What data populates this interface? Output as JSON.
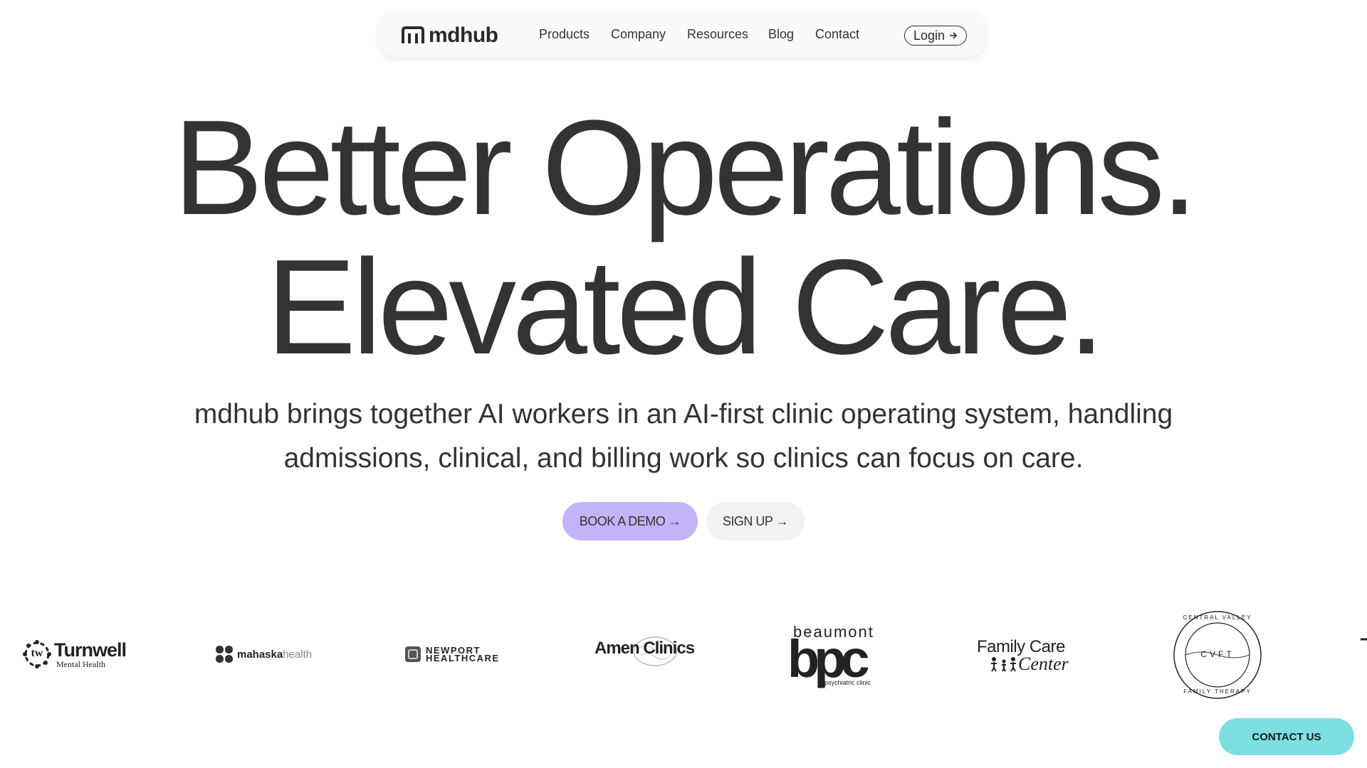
{
  "nav": {
    "brand": "mdhub",
    "items": [
      {
        "label": "Products"
      },
      {
        "label": "Company"
      },
      {
        "label": "Resources"
      },
      {
        "label": "Blog"
      },
      {
        "label": "Contact"
      }
    ],
    "login_label": "Login"
  },
  "hero": {
    "line1": "Better Operations.",
    "line2": "Elevated Care.",
    "subtext": "mdhub brings together AI workers in an AI-first clinic operating system, handling admissions, clinical, and billing work so clinics can focus on care.",
    "demo_button": "BOOK A DEMO →",
    "signup_button": "SIGN UP →"
  },
  "clients": {
    "turnwell": {
      "name": "Turnwell",
      "sub": "Mental Health",
      "mark": "tw"
    },
    "mahaska": {
      "name_bold": "mahaska",
      "name_light": "health"
    },
    "newport": {
      "line1": "NEWPORT",
      "line2": "HEALTHCARE"
    },
    "amen": {
      "name": "Amen Clinics"
    },
    "beaumont": {
      "top": "beaumont",
      "mark": "bpc",
      "sub": "psychiatric clinic"
    },
    "family": {
      "line1": "Family Care",
      "line2": "Center"
    },
    "cvft": {
      "mark": "CVFT",
      "top": "CENTRAL VALLEY",
      "bottom": "FAMILY THERAPY"
    },
    "partial": {
      "mark": "T"
    }
  },
  "contact_button": "CONTACT US",
  "colors": {
    "text": "#333333",
    "demo_button_bg": "#c4b3f7",
    "signup_button_bg": "#f2f2f2",
    "contact_button_bg": "#7ddfe0",
    "nav_bg": "#fafafa"
  }
}
